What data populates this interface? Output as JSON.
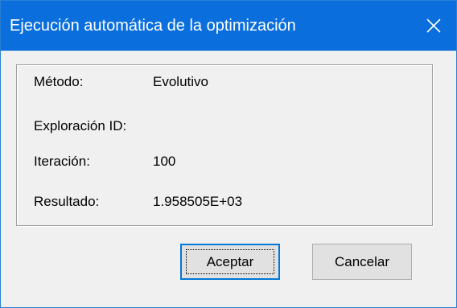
{
  "window": {
    "title": "Ejecución automática de la optimización",
    "titlebar_color": "#0a6fdd",
    "close_icon": "close-icon"
  },
  "info": {
    "method_label": "Método:",
    "method_value": "Evolutivo",
    "exploration_label": "Exploración ID:",
    "exploration_value": "",
    "iteration_label": "Iteración:",
    "iteration_value": "100",
    "result_label": "Resultado:",
    "result_value": "1.958505E+03"
  },
  "buttons": {
    "accept_label": "Aceptar",
    "cancel_label": "Cancelar"
  }
}
